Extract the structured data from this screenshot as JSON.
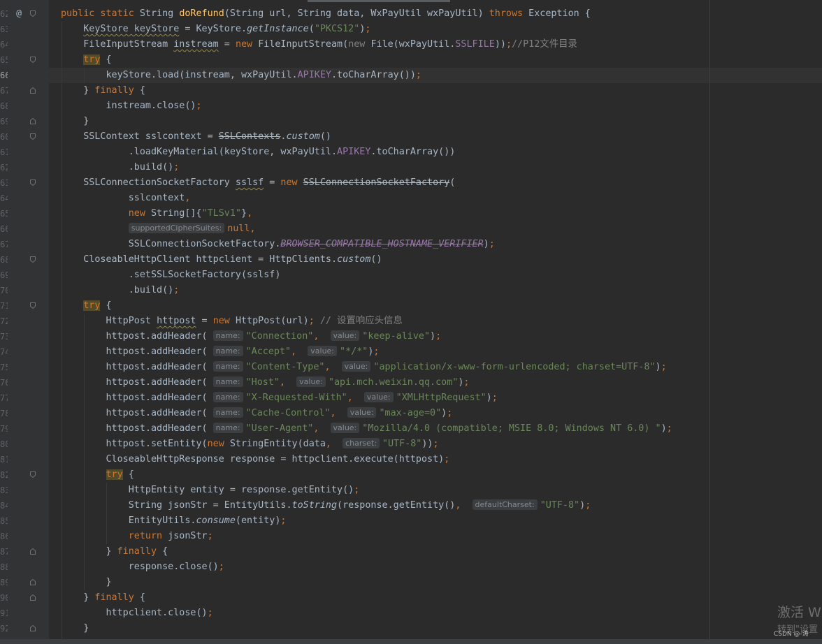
{
  "lines": [
    {
      "n": "62",
      "mark": "@",
      "fold": "open",
      "tokens": [
        [
          "k",
          "public static "
        ],
        [
          "t",
          "String "
        ],
        [
          "f",
          "doRefund"
        ],
        [
          "t",
          "(String url, String data, WxPayUtil wxPayUtil) "
        ],
        [
          "k",
          "throws "
        ],
        [
          "t",
          "Exception {"
        ]
      ]
    },
    {
      "n": "63",
      "tokens": [
        [
          "t",
          "    "
        ],
        [
          "tw",
          "KeyStore keyStore"
        ],
        [
          "t",
          " = KeyStore."
        ],
        [
          "sm",
          "getInstance"
        ],
        [
          "t",
          "("
        ],
        [
          "s",
          "\"PKCS12\""
        ],
        [
          "t",
          ")"
        ],
        [
          "k",
          ";"
        ]
      ]
    },
    {
      "n": "64",
      "tokens": [
        [
          "t",
          "    FileInputStream "
        ],
        [
          "tw",
          "instream"
        ],
        [
          "t",
          " = "
        ],
        [
          "k",
          "new "
        ],
        [
          "t",
          "FileInputStream("
        ],
        [
          "c",
          "new "
        ],
        [
          "t",
          "File(wxPayUtil."
        ],
        [
          "m",
          "SSLFILE"
        ],
        [
          "t",
          "))"
        ],
        [
          "k",
          ";"
        ],
        [
          "c",
          "//P12文件目录"
        ]
      ]
    },
    {
      "n": "65",
      "fold": "open",
      "tokens": [
        [
          "t",
          "    "
        ],
        [
          "kh",
          "try"
        ],
        [
          "t",
          " {"
        ]
      ]
    },
    {
      "n": "66",
      "current": true,
      "tokens": [
        [
          "t",
          "        keyStore.load(instream, wxPayUtil."
        ],
        [
          "m",
          "APIKEY"
        ],
        [
          "t",
          ".toCharArray())"
        ],
        [
          "k",
          ";"
        ]
      ]
    },
    {
      "n": "67",
      "fold": "close",
      "tokens": [
        [
          "t",
          "    } "
        ],
        [
          "k",
          "finally "
        ],
        [
          "t",
          "{"
        ]
      ]
    },
    {
      "n": "68",
      "tokens": [
        [
          "t",
          "        instream.close()"
        ],
        [
          "k",
          ";"
        ]
      ]
    },
    {
      "n": "69",
      "fold": "close",
      "tokens": [
        [
          "t",
          "    }"
        ]
      ]
    },
    {
      "n": "60",
      "fold": "open",
      "tokens": [
        [
          "t",
          "    SSLContext sslcontext = "
        ],
        [
          "tst",
          "SSLContexts"
        ],
        [
          "t",
          "."
        ],
        [
          "sm",
          "custom"
        ],
        [
          "t",
          "()"
        ]
      ]
    },
    {
      "n": "61",
      "tokens": [
        [
          "t",
          "            .loadKeyMaterial(keyStore, wxPayUtil."
        ],
        [
          "m",
          "APIKEY"
        ],
        [
          "t",
          ".toCharArray())"
        ]
      ]
    },
    {
      "n": "62",
      "tokens": [
        [
          "t",
          "            .build()"
        ],
        [
          "k",
          ";"
        ]
      ]
    },
    {
      "n": "63",
      "fold": "open",
      "tokens": [
        [
          "t",
          "    SSLConnectionSocketFactory "
        ],
        [
          "tw",
          "sslsf"
        ],
        [
          "t",
          " = "
        ],
        [
          "k",
          "new "
        ],
        [
          "tst",
          "SSLConnectionSocketFactory"
        ],
        [
          "t",
          "("
        ]
      ]
    },
    {
      "n": "64",
      "tokens": [
        [
          "t",
          "            sslcontext"
        ],
        [
          "k",
          ","
        ]
      ]
    },
    {
      "n": "65",
      "tokens": [
        [
          "t",
          "            "
        ],
        [
          "k",
          "new "
        ],
        [
          "t",
          "String[]{"
        ],
        [
          "s",
          "\"TLSv1\""
        ],
        [
          "t",
          "}"
        ],
        [
          "k",
          ","
        ]
      ]
    },
    {
      "n": "66",
      "tokens": [
        [
          "t",
          "            "
        ],
        [
          "hint",
          "supportedCipherSuites:"
        ],
        [
          "k",
          "null,"
        ]
      ]
    },
    {
      "n": "67",
      "tokens": [
        [
          "t",
          "            SSLConnectionSocketFactory."
        ],
        [
          "mst",
          "BROWSER_COMPATIBLE_HOSTNAME_VERIFIER"
        ],
        [
          "t",
          ")"
        ],
        [
          "k",
          ";"
        ]
      ]
    },
    {
      "n": "68",
      "fold": "open",
      "tokens": [
        [
          "t",
          "    CloseableHttpClient httpclient = HttpClients."
        ],
        [
          "sm",
          "custom"
        ],
        [
          "t",
          "()"
        ]
      ]
    },
    {
      "n": "69",
      "tokens": [
        [
          "t",
          "            .setSSLSocketFactory(sslsf)"
        ]
      ]
    },
    {
      "n": "70",
      "tokens": [
        [
          "t",
          "            .build()"
        ],
        [
          "k",
          ";"
        ]
      ]
    },
    {
      "n": "71",
      "fold": "open",
      "tokens": [
        [
          "t",
          "    "
        ],
        [
          "kh",
          "try"
        ],
        [
          "t",
          " {"
        ]
      ]
    },
    {
      "n": "72",
      "tokens": [
        [
          "t",
          "        HttpPost "
        ],
        [
          "tw",
          "httpost"
        ],
        [
          "t",
          " = "
        ],
        [
          "k",
          "new "
        ],
        [
          "t",
          "HttpPost(url)"
        ],
        [
          "k",
          "; "
        ],
        [
          "c",
          "// 设置响应头信息"
        ]
      ]
    },
    {
      "n": "73",
      "tokens": [
        [
          "t",
          "        httpost.addHeader( "
        ],
        [
          "hint",
          "name:"
        ],
        [
          "s",
          "\"Connection\""
        ],
        [
          "k",
          ",  "
        ],
        [
          "hint",
          "value:"
        ],
        [
          "s",
          "\"keep-alive\""
        ],
        [
          "t",
          ")"
        ],
        [
          "k",
          ";"
        ]
      ]
    },
    {
      "n": "74",
      "tokens": [
        [
          "t",
          "        httpost.addHeader( "
        ],
        [
          "hint",
          "name:"
        ],
        [
          "s",
          "\"Accept\""
        ],
        [
          "k",
          ",  "
        ],
        [
          "hint",
          "value:"
        ],
        [
          "s",
          "\"*/*\""
        ],
        [
          "t",
          ")"
        ],
        [
          "k",
          ";"
        ]
      ]
    },
    {
      "n": "75",
      "tokens": [
        [
          "t",
          "        httpost.addHeader( "
        ],
        [
          "hint",
          "name:"
        ],
        [
          "s",
          "\"Content-Type\""
        ],
        [
          "k",
          ",  "
        ],
        [
          "hint",
          "value:"
        ],
        [
          "s",
          "\"application/x-www-form-urlencoded; charset=UTF-8\""
        ],
        [
          "t",
          ")"
        ],
        [
          "k",
          ";"
        ]
      ]
    },
    {
      "n": "76",
      "tokens": [
        [
          "t",
          "        httpost.addHeader( "
        ],
        [
          "hint",
          "name:"
        ],
        [
          "s",
          "\"Host\""
        ],
        [
          "k",
          ",  "
        ],
        [
          "hint",
          "value:"
        ],
        [
          "s",
          "\"api.mch.weixin.qq.com\""
        ],
        [
          "t",
          ")"
        ],
        [
          "k",
          ";"
        ]
      ]
    },
    {
      "n": "77",
      "tokens": [
        [
          "t",
          "        httpost.addHeader( "
        ],
        [
          "hint",
          "name:"
        ],
        [
          "s",
          "\"X-Requested-With\""
        ],
        [
          "k",
          ",  "
        ],
        [
          "hint",
          "value:"
        ],
        [
          "s",
          "\"XMLHttpRequest\""
        ],
        [
          "t",
          ")"
        ],
        [
          "k",
          ";"
        ]
      ]
    },
    {
      "n": "78",
      "tokens": [
        [
          "t",
          "        httpost.addHeader( "
        ],
        [
          "hint",
          "name:"
        ],
        [
          "s",
          "\"Cache-Control\""
        ],
        [
          "k",
          ",  "
        ],
        [
          "hint",
          "value:"
        ],
        [
          "s",
          "\"max-age=0\""
        ],
        [
          "t",
          ")"
        ],
        [
          "k",
          ";"
        ]
      ]
    },
    {
      "n": "79",
      "tokens": [
        [
          "t",
          "        httpost.addHeader( "
        ],
        [
          "hint",
          "name:"
        ],
        [
          "s",
          "\"User-Agent\""
        ],
        [
          "k",
          ",  "
        ],
        [
          "hint",
          "value:"
        ],
        [
          "s",
          "\"Mozilla/4.0 (compatible; MSIE 8.0; Windows NT 6.0) \""
        ],
        [
          "t",
          ")"
        ],
        [
          "k",
          ";"
        ]
      ]
    },
    {
      "n": "80",
      "tokens": [
        [
          "t",
          "        httpost.setEntity("
        ],
        [
          "k",
          "new "
        ],
        [
          "t",
          "StringEntity(data"
        ],
        [
          "k",
          ",  "
        ],
        [
          "hint",
          "charset:"
        ],
        [
          "s",
          "\"UTF-8\""
        ],
        [
          "t",
          "))"
        ],
        [
          "k",
          ";"
        ]
      ]
    },
    {
      "n": "81",
      "tokens": [
        [
          "t",
          "        CloseableHttpResponse response = httpclient.execute(httpost)"
        ],
        [
          "k",
          ";"
        ]
      ]
    },
    {
      "n": "82",
      "fold": "open",
      "tokens": [
        [
          "t",
          "        "
        ],
        [
          "kh",
          "try"
        ],
        [
          "t",
          " {"
        ]
      ]
    },
    {
      "n": "83",
      "tokens": [
        [
          "t",
          "            HttpEntity entity = response.getEntity()"
        ],
        [
          "k",
          ";"
        ]
      ]
    },
    {
      "n": "84",
      "tokens": [
        [
          "t",
          "            String jsonStr = EntityUtils."
        ],
        [
          "sm",
          "toString"
        ],
        [
          "t",
          "(response.getEntity()"
        ],
        [
          "k",
          ",  "
        ],
        [
          "hint",
          "defaultCharset:"
        ],
        [
          "s",
          "\"UTF-8\""
        ],
        [
          "t",
          ")"
        ],
        [
          "k",
          ";"
        ]
      ]
    },
    {
      "n": "85",
      "tokens": [
        [
          "t",
          "            EntityUtils."
        ],
        [
          "sm",
          "consume"
        ],
        [
          "t",
          "(entity)"
        ],
        [
          "k",
          ";"
        ]
      ]
    },
    {
      "n": "86",
      "tokens": [
        [
          "t",
          "            "
        ],
        [
          "k",
          "return "
        ],
        [
          "t",
          "jsonStr"
        ],
        [
          "k",
          ";"
        ]
      ]
    },
    {
      "n": "87",
      "fold": "close",
      "tokens": [
        [
          "t",
          "        } "
        ],
        [
          "k",
          "finally "
        ],
        [
          "t",
          "{"
        ]
      ]
    },
    {
      "n": "88",
      "tokens": [
        [
          "t",
          "            response.close()"
        ],
        [
          "k",
          ";"
        ]
      ]
    },
    {
      "n": "89",
      "fold": "close",
      "tokens": [
        [
          "t",
          "        }"
        ]
      ]
    },
    {
      "n": "90",
      "fold": "close",
      "tokens": [
        [
          "t",
          "    } "
        ],
        [
          "k",
          "finally "
        ],
        [
          "t",
          "{"
        ]
      ]
    },
    {
      "n": "91",
      "tokens": [
        [
          "t",
          "        httpclient.close()"
        ],
        [
          "k",
          ";"
        ]
      ]
    },
    {
      "n": "92",
      "fold": "close",
      "tokens": [
        [
          "t",
          "    }"
        ]
      ]
    }
  ],
  "watermark": {
    "line1": "激活 W",
    "line2": "转到\"设置",
    "credit": "CSDN @-涛"
  }
}
